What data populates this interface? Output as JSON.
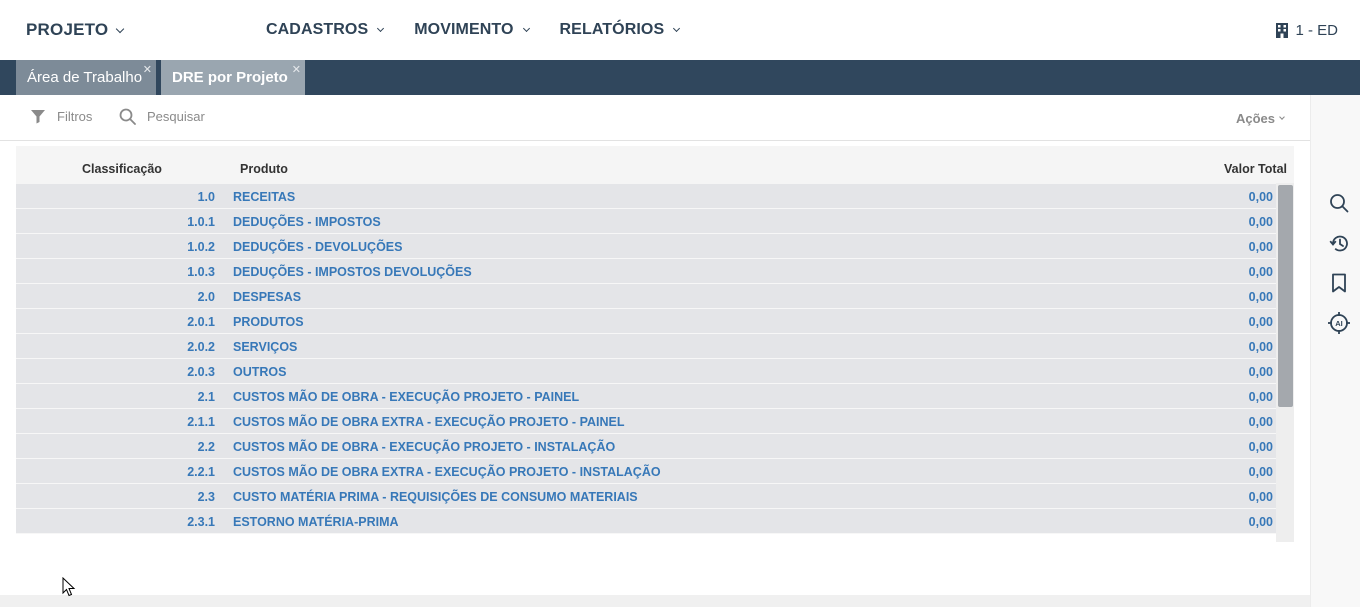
{
  "nav": {
    "brand": "PROJETO",
    "menu": [
      {
        "label": "CADASTROS"
      },
      {
        "label": "MOVIMENTO"
      },
      {
        "label": "RELATÓRIOS"
      }
    ],
    "company": "1 - ED"
  },
  "tabs": [
    {
      "label": "Área de Trabalho",
      "active": false
    },
    {
      "label": "DRE por Projeto",
      "active": true
    }
  ],
  "toolbar": {
    "filters_label": "Filtros",
    "search_label": "Pesquisar",
    "actions_label": "Ações"
  },
  "grid": {
    "columns": [
      "Classificação",
      "Produto",
      "Valor Total"
    ],
    "rows": [
      {
        "classificacao": "1.0",
        "produto": "RECEITAS",
        "valor": "0,00"
      },
      {
        "classificacao": "1.0.1",
        "produto": "DEDUÇÕES - IMPOSTOS",
        "valor": "0,00"
      },
      {
        "classificacao": "1.0.2",
        "produto": "DEDUÇÕES - DEVOLUÇÕES",
        "valor": "0,00"
      },
      {
        "classificacao": "1.0.3",
        "produto": "DEDUÇÕES - IMPOSTOS DEVOLUÇÕES",
        "valor": "0,00"
      },
      {
        "classificacao": "2.0",
        "produto": "DESPESAS",
        "valor": "0,00"
      },
      {
        "classificacao": "2.0.1",
        "produto": "PRODUTOS",
        "valor": "0,00"
      },
      {
        "classificacao": "2.0.2",
        "produto": "SERVIÇOS",
        "valor": "0,00"
      },
      {
        "classificacao": "2.0.3",
        "produto": "OUTROS",
        "valor": "0,00"
      },
      {
        "classificacao": "2.1",
        "produto": "CUSTOS MÃO DE OBRA - EXECUÇÃO PROJETO - PAINEL",
        "valor": "0,00"
      },
      {
        "classificacao": "2.1.1",
        "produto": "CUSTOS MÃO DE OBRA EXTRA - EXECUÇÃO PROJETO - PAINEL",
        "valor": "0,00"
      },
      {
        "classificacao": "2.2",
        "produto": "CUSTOS MÃO DE OBRA - EXECUÇÃO PROJETO - INSTALAÇÃO",
        "valor": "0,00"
      },
      {
        "classificacao": "2.2.1",
        "produto": "CUSTOS MÃO DE OBRA EXTRA - EXECUÇÃO PROJETO - INSTALAÇÃO",
        "valor": "0,00"
      },
      {
        "classificacao": "2.3",
        "produto": "CUSTO MATÉRIA PRIMA - REQUISIÇÕES DE CONSUMO MATERIAIS",
        "valor": "0,00"
      },
      {
        "classificacao": "2.3.1",
        "produto": "ESTORNO MATÉRIA-PRIMA",
        "valor": "0,00"
      }
    ]
  },
  "rail": [
    {
      "icon": "search-icon"
    },
    {
      "icon": "history-icon"
    },
    {
      "icon": "bookmark-icon"
    },
    {
      "icon": "ai-target-icon"
    }
  ],
  "colors": {
    "nav_text": "#2f4356",
    "tabstrip": "#30475d",
    "row_bg": "#e4e5e8",
    "link_text": "#3778b8"
  }
}
